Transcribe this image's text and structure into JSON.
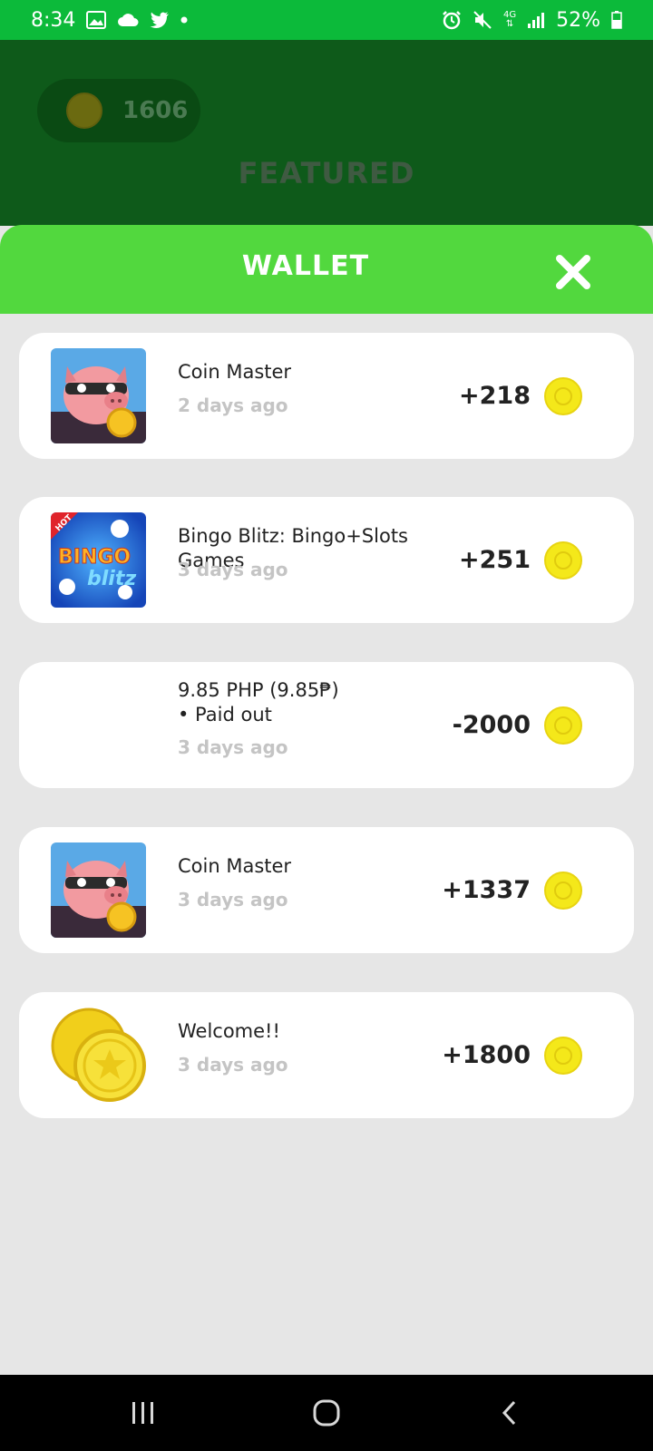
{
  "status_bar": {
    "time": "8:34",
    "network": "4G",
    "battery": "52%"
  },
  "background": {
    "coin_balance": "1606",
    "featured_label": "FEATURED"
  },
  "wallet": {
    "title": "WALLET",
    "close_icon": "close-icon",
    "items": [
      {
        "title": "Coin Master",
        "time": "2 days ago",
        "amount": "+218",
        "thumb": "coin-master-app-icon"
      },
      {
        "title": "Bingo Blitz: Bingo+Slots Games",
        "time": "3 days ago",
        "amount": "+251",
        "thumb": "bingo-blitz-app-icon"
      },
      {
        "title": "9.85 PHP (9.85₱)",
        "subtitle": "• Paid out",
        "time": "3 days ago",
        "amount": "-2000",
        "thumb": ""
      },
      {
        "title": "Coin Master",
        "time": "3 days ago",
        "amount": "+1337",
        "thumb": "coin-master-app-icon"
      },
      {
        "title": "Welcome!!",
        "time": "3 days ago",
        "amount": "+1800",
        "thumb": "gold-coins-icon"
      }
    ]
  },
  "colors": {
    "status_bar": "#0cba3a",
    "header_green": "#52d83e",
    "background": "#e6e6e6",
    "coin_yellow": "#f4e81a"
  }
}
